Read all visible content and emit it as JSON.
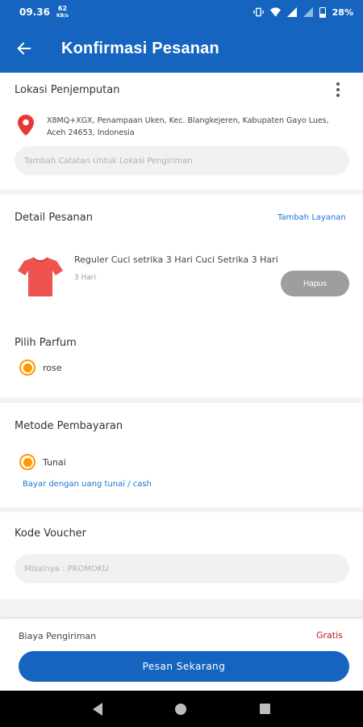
{
  "status_bar": {
    "time": "09.36",
    "net_speed_value": "62",
    "net_speed_unit": "KB/s",
    "battery": "28%"
  },
  "app_bar": {
    "title": "Konfirmasi Pesanan",
    "back_icon": "arrow-left-icon"
  },
  "pickup": {
    "title": "Lokasi Penjemputan",
    "address": "X8MQ+XGX, Penampaan Uken, Kec. Blangkejeren, Kabupaten Gayo Lues, Aceh 24653, Indonesia",
    "note_placeholder": "Tambah Catatan Untuk Lokasi Pengiriman",
    "pin_color": "#e53935"
  },
  "order": {
    "title": "Detail Pesanan",
    "add_service_label": "Tambah Layanan",
    "item_name": "Reguler Cuci setrika 3 Hari Cuci Setrika 3 Hari",
    "item_duration": "3 Hari",
    "remove_label": "Hapus",
    "shirt_color": "#ef5350"
  },
  "perfume": {
    "title": "Pilih Parfum",
    "selected": "rose"
  },
  "payment": {
    "title": "Metode Pembayaran",
    "selected": "Tunai",
    "note": "Bayar dengan uang tunai / cash"
  },
  "voucher": {
    "title": "Kode Voucher",
    "placeholder": "Misalnya : PROMOKU"
  },
  "summary": {
    "shipping_label": "Biaya Pengiriman",
    "shipping_value": "Gratis",
    "order_button": "Pesan Sekarang"
  },
  "colors": {
    "primary": "#1565c0",
    "radio_accent": "#ff9800",
    "free_text": "#b71c1c"
  }
}
